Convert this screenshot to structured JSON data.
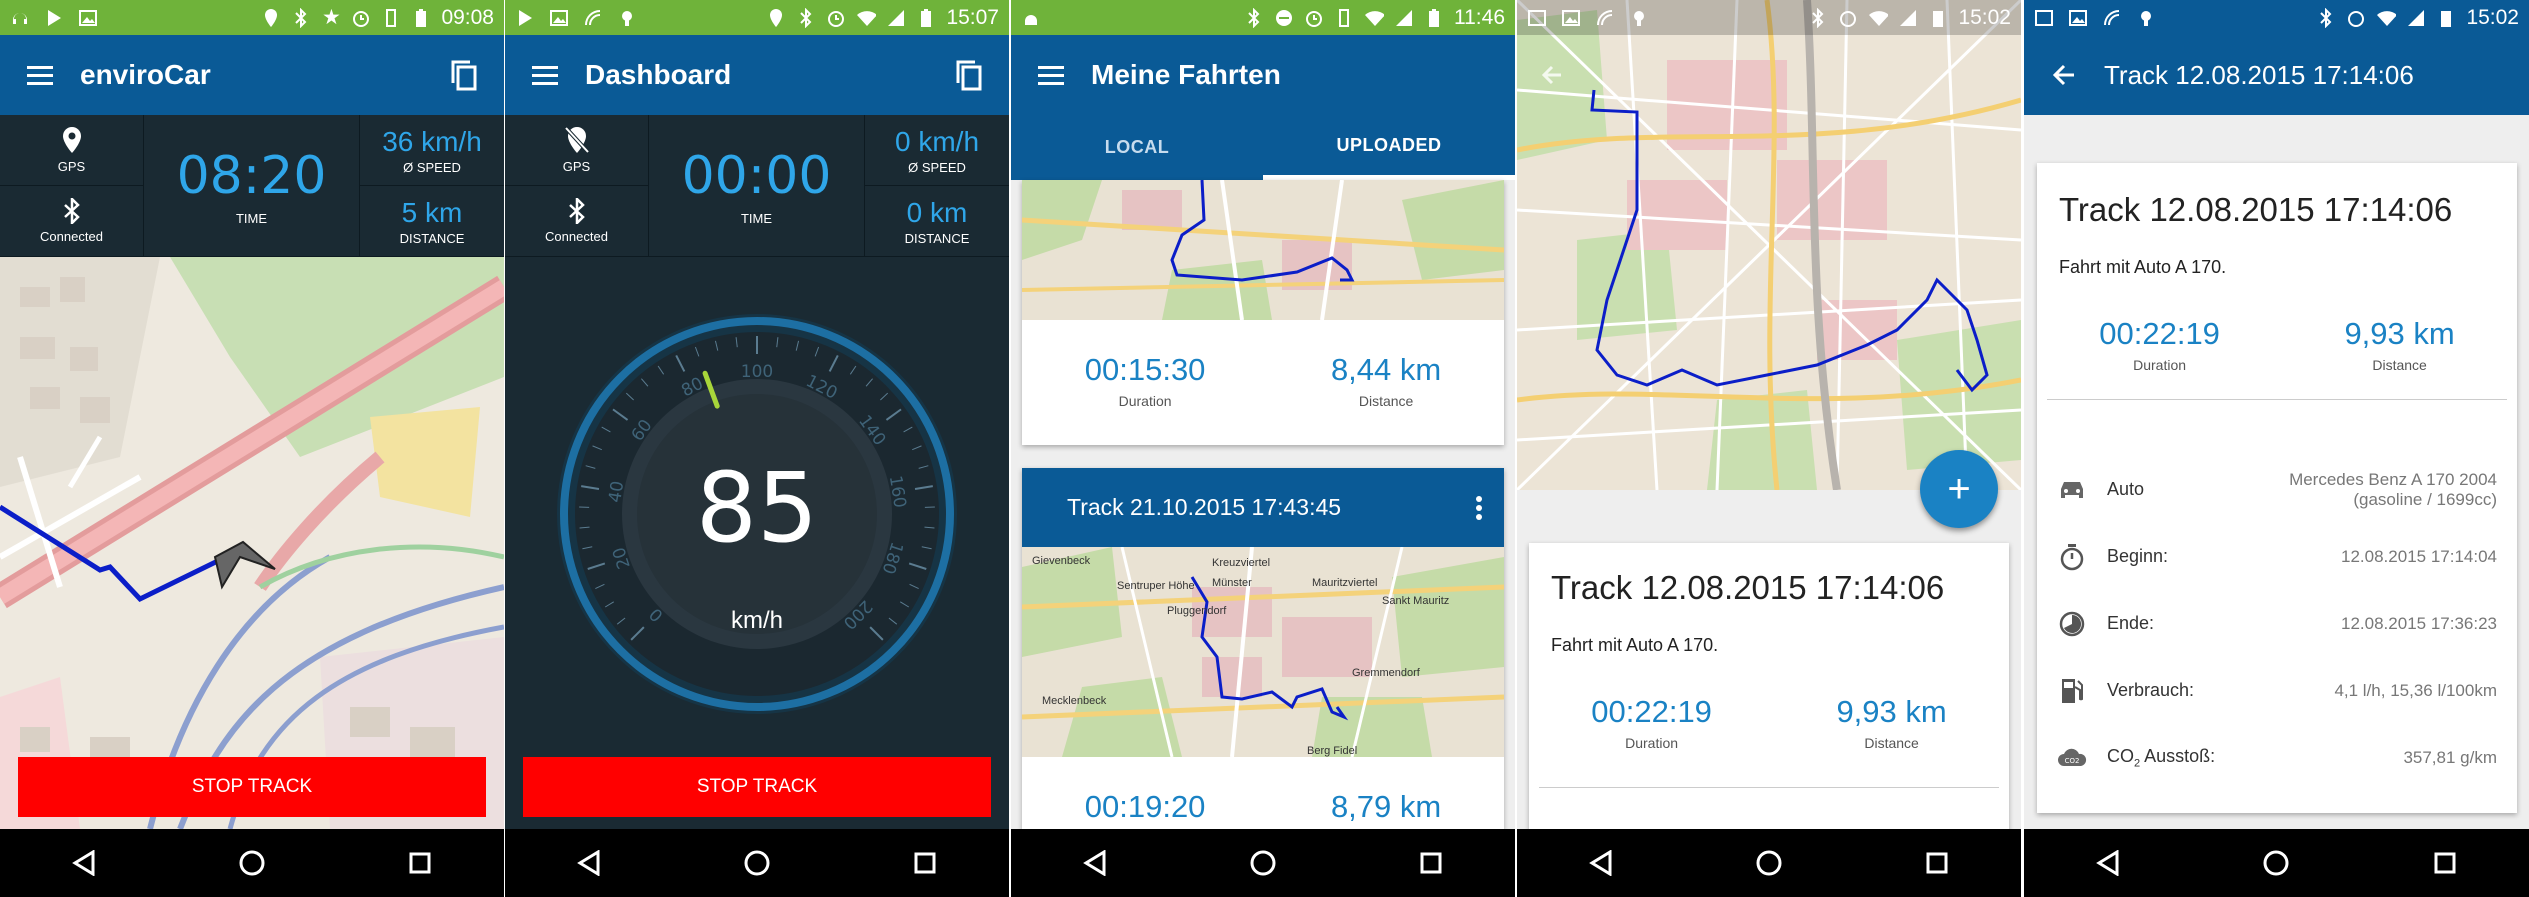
{
  "colors": {
    "primary": "#0a5a96",
    "accent": "#1a82c4",
    "stop": "#ff0000",
    "dash_bg": "#1a2a33",
    "status_green": "#6fb33a"
  },
  "screen1": {
    "status_time": "09:08",
    "app_title": "enviroCar",
    "gps_label": "GPS",
    "bt_label": "Connected",
    "time_value": "08:20",
    "time_label": "TIME",
    "speed_value": "36 km/h",
    "speed_label": "Ø SPEED",
    "distance_value": "5 km",
    "distance_label": "DISTANCE",
    "stop_label": "STOP TRACK"
  },
  "screen2": {
    "status_time": "15:07",
    "app_title": "Dashboard",
    "gps_label": "GPS",
    "bt_label": "Connected",
    "time_value": "00:00",
    "time_label": "TIME",
    "speed_value": "0 km/h",
    "speed_label": "Ø SPEED",
    "distance_value": "0 km",
    "distance_label": "DISTANCE",
    "speed_big": "85",
    "speed_unit": "km/h",
    "gauge_ticks": [
      "0",
      "20",
      "40",
      "60",
      "80",
      "100",
      "120",
      "140",
      "160",
      "180",
      "200"
    ],
    "needle_value": 85,
    "stop_label": "STOP TRACK"
  },
  "screen3": {
    "status_time": "11:46",
    "app_title": "Meine Fahrten",
    "tab_local": "LOCAL",
    "tab_uploaded": "UPLOADED",
    "card1": {
      "duration": "00:15:30",
      "duration_label": "Duration",
      "distance": "8,44 km",
      "distance_label": "Distance"
    },
    "card2": {
      "title": "Track 21.10.2015 17:43:45",
      "duration": "00:19:20",
      "distance": "8,79 km",
      "map_labels": [
        "Gievenbeck",
        "Kreuzviertel",
        "Sentruper Höhe",
        "Münster",
        "Mauritzviertel",
        "Sankt Mauritz",
        "Pluggendorf",
        "Mecklenbeck",
        "Gremmendorf",
        "Berg Fidel"
      ]
    }
  },
  "screen4": {
    "status_time": "15:02",
    "fab_label": "+",
    "card_title": "Track 12.08.2015 17:14:06",
    "subtitle": "Fahrt mit Auto A 170.",
    "duration": "00:22:19",
    "duration_label": "Duration",
    "distance": "9,93 km",
    "distance_label": "Distance"
  },
  "screen5": {
    "status_time": "15:02",
    "app_title": "Track 12.08.2015 17:14:06",
    "card_title": "Track 12.08.2015 17:14:06",
    "subtitle": "Fahrt mit Auto A 170.",
    "duration": "00:22:19",
    "duration_label": "Duration",
    "distance": "9,93 km",
    "distance_label": "Distance",
    "rows": [
      {
        "icon": "car-icon",
        "label": "Auto",
        "value": "Mercedes Benz A 170 2004",
        "value2": "(gasoline / 1699cc)"
      },
      {
        "icon": "timer-icon",
        "label": "Beginn:",
        "value": "12.08.2015 17:14:04"
      },
      {
        "icon": "clock-end-icon",
        "label": "Ende:",
        "value": "12.08.2015 17:36:23"
      },
      {
        "icon": "fuel-pump-icon",
        "label": "Verbrauch:",
        "value": "4,1 l/h, 15,36 l/100km"
      },
      {
        "icon": "co2-cloud-icon",
        "label": "CO",
        "label_sub": "2",
        "label_rest": " Ausstoß:",
        "value": "357,81 g/km"
      }
    ]
  }
}
